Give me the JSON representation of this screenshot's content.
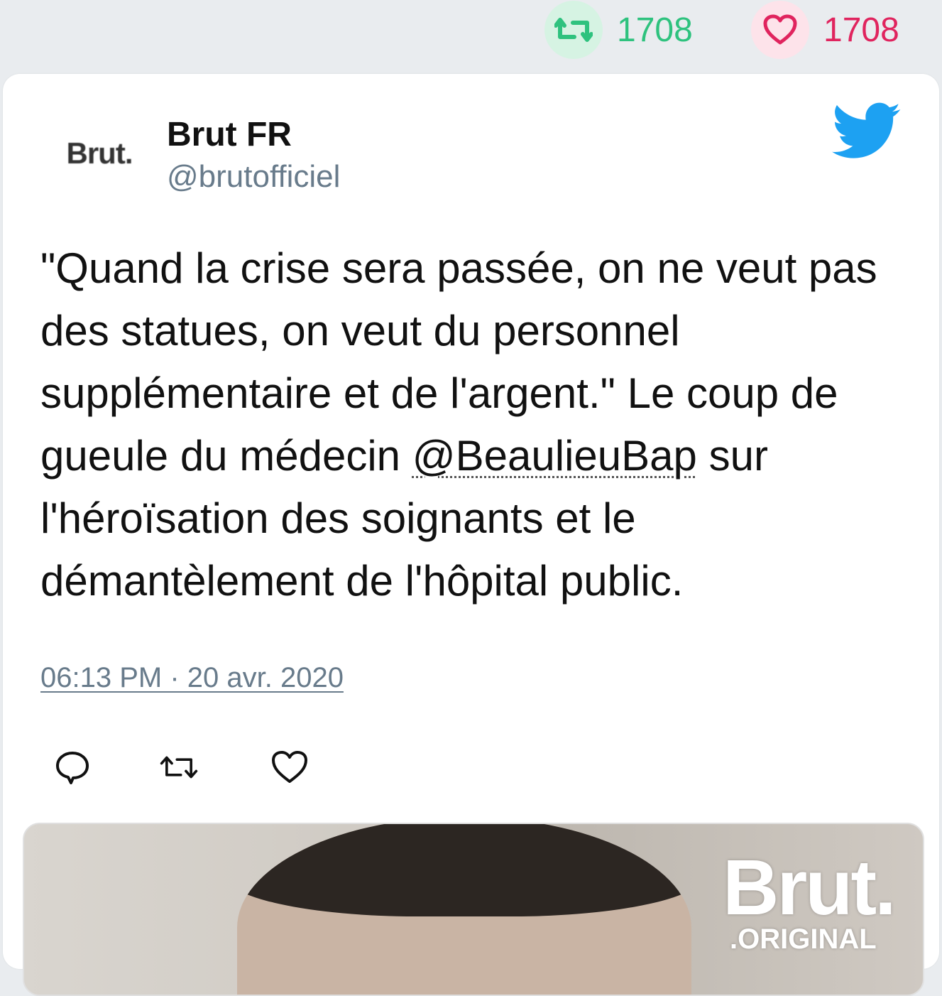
{
  "stats": {
    "retweets": "1708",
    "likes": "1708",
    "retweet_color": "#2ec27e",
    "like_color": "#e0245e"
  },
  "tweet": {
    "avatar_text": "Brut.",
    "name": "Brut FR",
    "handle": "@brutofficiel",
    "text_before": "\"Quand la crise sera passée, on ne veut pas des statues, on veut du personnel supplémentaire et de l'argent.\" Le coup de gueule du médecin ",
    "mention": "@BeaulieuBap",
    "text_after": " sur l'héroïsation des soignants et le démantèlement de l'hôpital public.",
    "timestamp": "06:13 PM · 20 avr. 2020",
    "icons": [
      "twitter-bird-icon",
      "reply-icon",
      "retweet-icon",
      "like-icon"
    ],
    "accent": "#1da1f2"
  },
  "media": {
    "logo_main": "Brut.",
    "logo_sub": ".ORIGINAL"
  }
}
